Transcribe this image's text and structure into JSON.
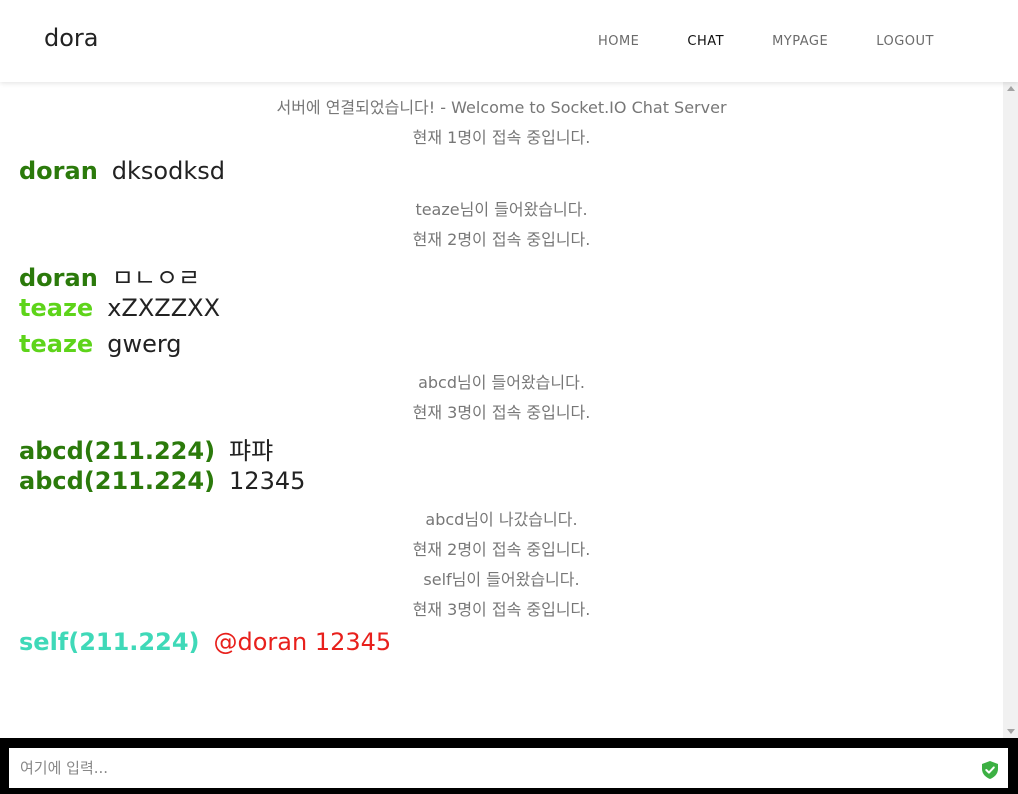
{
  "nav": {
    "brand": "dora",
    "links": [
      "HOME",
      "CHAT",
      "MYPAGE",
      "LOGOUT"
    ],
    "active": "CHAT"
  },
  "chat": {
    "entries": [
      {
        "type": "system",
        "text": "서버에 연결되었습니다! - Welcome to Socket.IO Chat Server"
      },
      {
        "type": "system",
        "text": "현재 1명이 접속 중입니다."
      },
      {
        "type": "message",
        "user": "doran",
        "text": "dksodksd",
        "user_color": "#2b7a0b",
        "text_color": "#222222"
      },
      {
        "type": "system",
        "text": "teaze님이 들어왔습니다."
      },
      {
        "type": "system",
        "text": "현재 2명이 접속 중입니다."
      },
      {
        "type": "message",
        "user": "doran",
        "text": "ㅁㄴㅇㄹ",
        "user_color": "#2b7a0b",
        "text_color": "#222222"
      },
      {
        "type": "message",
        "user": "teaze",
        "text": "xZXZZXX",
        "user_color": "#5ed41a",
        "text_color": "#222222"
      },
      {
        "type": "message",
        "user": "teaze",
        "text": "gwerg",
        "user_color": "#5ed41a",
        "text_color": "#222222"
      },
      {
        "type": "system",
        "text": "abcd님이 들어왔습니다."
      },
      {
        "type": "system",
        "text": "현재 3명이 접속 중입니다."
      },
      {
        "type": "message",
        "user": "abcd(211.224)",
        "text": "퍄퍄",
        "user_color": "#2b7a0b",
        "text_color": "#222222"
      },
      {
        "type": "message",
        "user": "abcd(211.224)",
        "text": "12345",
        "user_color": "#2b7a0b",
        "text_color": "#222222"
      },
      {
        "type": "system",
        "text": "abcd님이 나갔습니다."
      },
      {
        "type": "system",
        "text": "현재 2명이 접속 중입니다."
      },
      {
        "type": "system",
        "text": "self님이 들어왔습니다."
      },
      {
        "type": "system",
        "text": "현재 3명이 접속 중입니다."
      },
      {
        "type": "message",
        "user": "self(211.224)",
        "text": "@doran 12345",
        "user_color": "#3fd9b8",
        "text_color": "#e8201c"
      }
    ]
  },
  "input": {
    "placeholder": "여기에 입력...",
    "value": "",
    "icon": "shield-check-icon",
    "icon_color": "#3cb043"
  }
}
